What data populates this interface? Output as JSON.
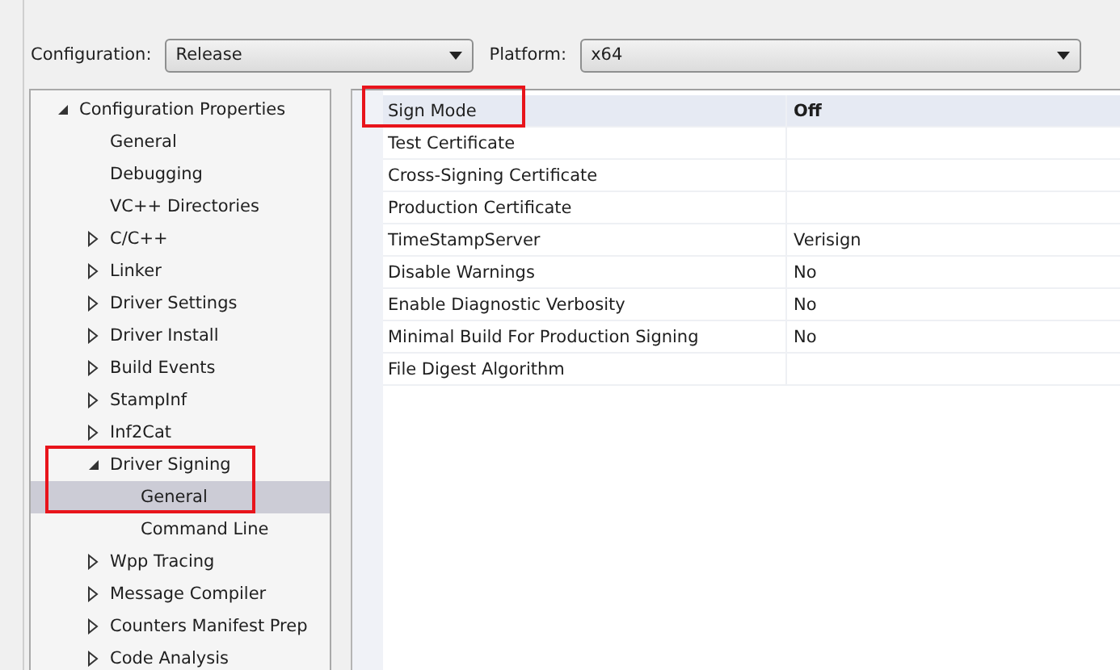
{
  "toolbar": {
    "configuration": {
      "label": "Configuration:",
      "value": "Release"
    },
    "platform": {
      "label": "Platform:",
      "value": "x64"
    }
  },
  "tree": [
    {
      "label": "Configuration Properties",
      "kind": "group",
      "expanded": true,
      "selected": false,
      "highlighted": false,
      "children": [
        {
          "label": "General",
          "kind": "leaf",
          "selected": false,
          "highlighted": false
        },
        {
          "label": "Debugging",
          "kind": "leaf",
          "selected": false,
          "highlighted": false
        },
        {
          "label": "VC++ Directories",
          "kind": "leaf",
          "selected": false,
          "highlighted": false
        },
        {
          "label": "C/C++",
          "kind": "group",
          "expanded": false,
          "selected": false,
          "highlighted": false
        },
        {
          "label": "Linker",
          "kind": "group",
          "expanded": false,
          "selected": false,
          "highlighted": false
        },
        {
          "label": "Driver Settings",
          "kind": "group",
          "expanded": false,
          "selected": false,
          "highlighted": false
        },
        {
          "label": "Driver Install",
          "kind": "group",
          "expanded": false,
          "selected": false,
          "highlighted": false
        },
        {
          "label": "Build Events",
          "kind": "group",
          "expanded": false,
          "selected": false,
          "highlighted": false
        },
        {
          "label": "StampInf",
          "kind": "group",
          "expanded": false,
          "selected": false,
          "highlighted": false
        },
        {
          "label": "Inf2Cat",
          "kind": "group",
          "expanded": false,
          "selected": false,
          "highlighted": false
        },
        {
          "label": "Driver Signing",
          "kind": "group",
          "expanded": true,
          "selected": false,
          "highlighted": true,
          "children": [
            {
              "label": "General",
              "kind": "leaf",
              "selected": true,
              "highlighted": false
            },
            {
              "label": "Command Line",
              "kind": "leaf",
              "selected": false,
              "highlighted": false
            }
          ]
        },
        {
          "label": "Wpp Tracing",
          "kind": "group",
          "expanded": false,
          "selected": false,
          "highlighted": false
        },
        {
          "label": "Message Compiler",
          "kind": "group",
          "expanded": false,
          "selected": false,
          "highlighted": false
        },
        {
          "label": "Counters Manifest Prep",
          "kind": "group",
          "expanded": false,
          "selected": false,
          "highlighted": false
        },
        {
          "label": "Code Analysis",
          "kind": "group",
          "expanded": false,
          "selected": false,
          "highlighted": false
        }
      ]
    }
  ],
  "properties": [
    {
      "name": "Sign Mode",
      "value": "Off",
      "selected": true,
      "highlighted": true
    },
    {
      "name": "Test Certificate",
      "selected": false,
      "highlighted": false
    },
    {
      "name": "Cross-Signing Certificate",
      "selected": false,
      "highlighted": false
    },
    {
      "name": "Production Certificate",
      "selected": false,
      "highlighted": false
    },
    {
      "name": "TimeStampServer",
      "value": "Verisign",
      "selected": false,
      "highlighted": false
    },
    {
      "name": "Disable Warnings",
      "value": "No",
      "selected": false,
      "highlighted": false
    },
    {
      "name": "Enable Diagnostic Verbosity",
      "value": "No",
      "selected": false,
      "highlighted": false
    },
    {
      "name": "Minimal Build For Production Signing",
      "value": "No",
      "selected": false,
      "highlighted": false
    },
    {
      "name": "File Digest Algorithm",
      "selected": false,
      "highlighted": false
    }
  ]
}
